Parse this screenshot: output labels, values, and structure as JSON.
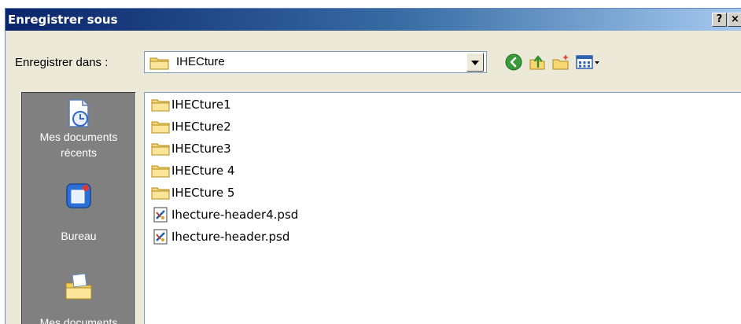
{
  "window": {
    "title": "Enregistrer sous",
    "help_label": "?",
    "close_label": "×"
  },
  "toolbar": {
    "save_in_label": "Enregistrer dans :",
    "current_folder": "IHECture",
    "icons": [
      "back-icon",
      "up-folder-icon",
      "new-folder-icon",
      "views-menu-icon"
    ]
  },
  "places": [
    {
      "label_line1": "Mes documents",
      "label_line2": "récents",
      "icon": "recent-documents-icon"
    },
    {
      "label_line1": "Bureau",
      "label_line2": "",
      "icon": "desktop-icon"
    },
    {
      "label_line1": "Mes documents",
      "label_line2": "",
      "icon": "my-documents-icon"
    }
  ],
  "files": [
    {
      "name": "IHECture1",
      "type": "folder"
    },
    {
      "name": "IHECture2",
      "type": "folder"
    },
    {
      "name": "IHECture3",
      "type": "folder"
    },
    {
      "name": "IHECture 4",
      "type": "folder"
    },
    {
      "name": "IHECture 5",
      "type": "folder"
    },
    {
      "name": "Ihecture-header4.psd",
      "type": "psd"
    },
    {
      "name": "Ihecture-header.psd",
      "type": "psd"
    }
  ],
  "colors": {
    "title_start": "#0a246a",
    "title_end": "#a6caf0",
    "places_bg": "#808080",
    "dialog_bg": "#ece9d8"
  }
}
